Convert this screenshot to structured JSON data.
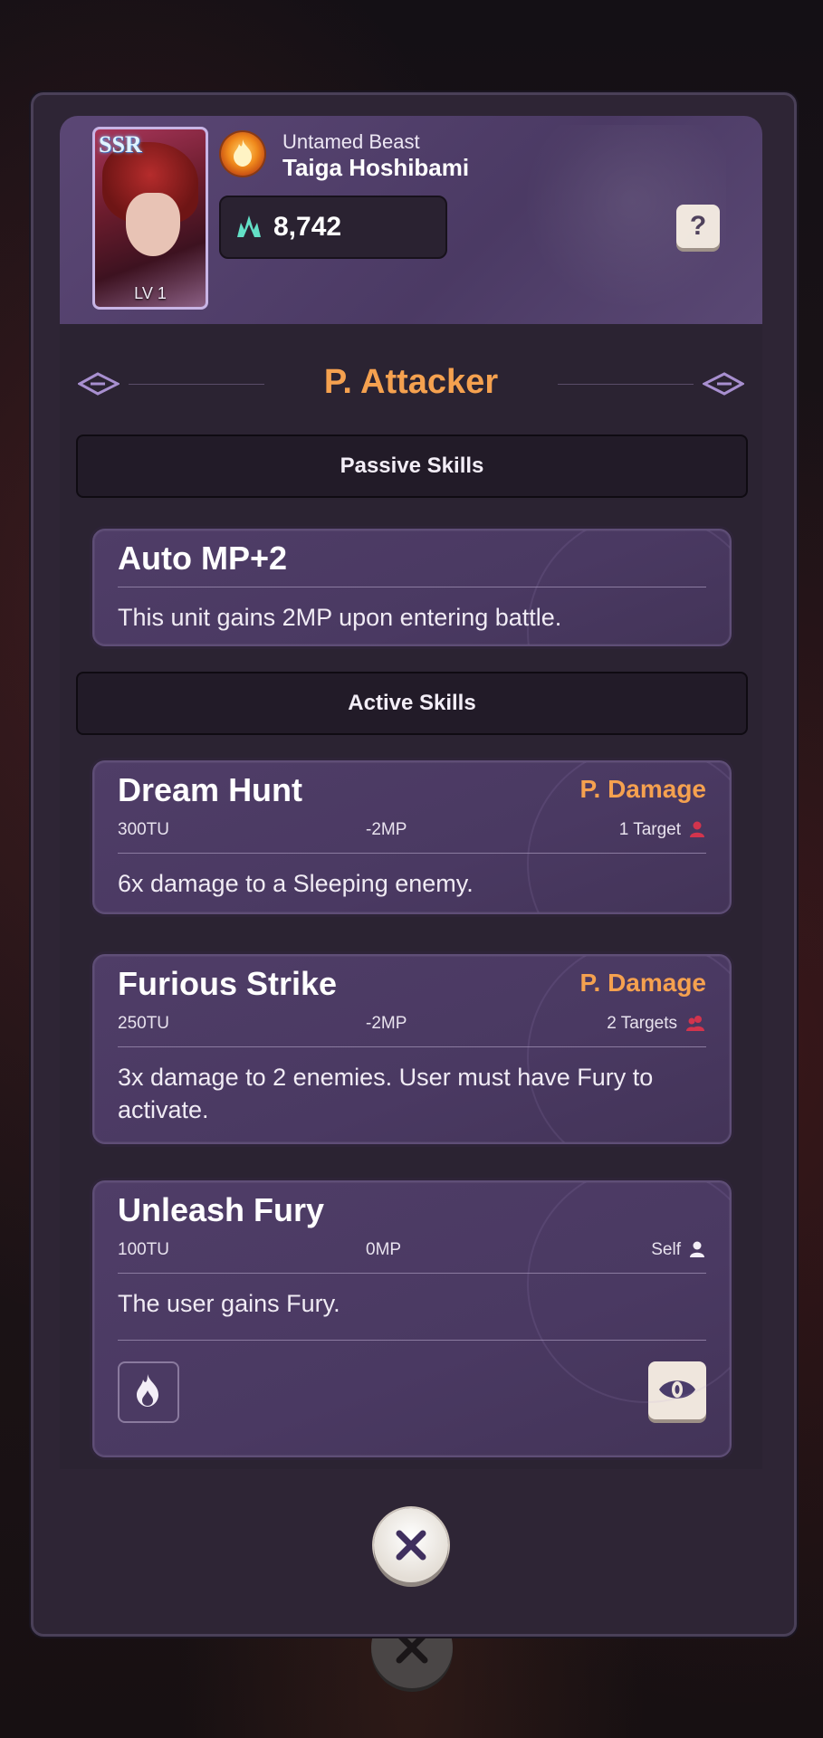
{
  "character": {
    "rarity": "SSR",
    "level": "LV 1",
    "class_name": "Untamed Beast",
    "name": "Taiga Hoshibami",
    "power": "8,742",
    "element_icon": "fire-element-icon"
  },
  "help_label": "?",
  "role_title": "P. Attacker",
  "sections": {
    "passive_title": "Passive Skills",
    "active_title": "Active Skills"
  },
  "passive_skills": [
    {
      "name": "Auto MP+2",
      "description": "This unit gains 2MP upon entering battle."
    }
  ],
  "active_skills": [
    {
      "name": "Dream Hunt",
      "type": "P. Damage",
      "tu": "300TU",
      "mp": "-2MP",
      "target": "1 Target",
      "description": "6x damage to a Sleeping enemy."
    },
    {
      "name": "Furious Strike",
      "type": "P. Damage",
      "tu": "250TU",
      "mp": "-2MP",
      "target": "2 Targets",
      "description": "3x damage to 2 enemies. User must have Fury to activate."
    },
    {
      "name": "Unleash Fury",
      "type": "",
      "tu": "100TU",
      "mp": "0MP",
      "target": "Self",
      "description": "The user gains Fury."
    }
  ],
  "colors": {
    "accent_orange": "#f5a14f",
    "panel": "#2e2535",
    "card": "#4a3962",
    "target_red": "#d2344d"
  }
}
